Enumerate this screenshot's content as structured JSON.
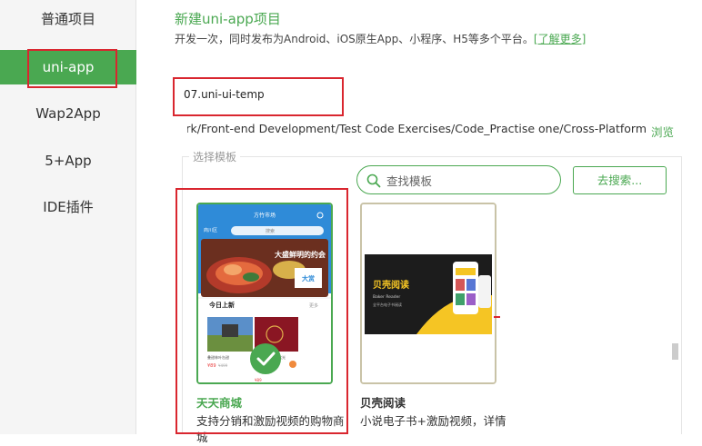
{
  "sidebar": {
    "items": [
      {
        "label": "普通项目"
      },
      {
        "label": "uni-app"
      },
      {
        "label": "Wap2App"
      },
      {
        "label": "5+App"
      },
      {
        "label": "IDE插件"
      }
    ]
  },
  "header": {
    "title": "新建uni-app项目",
    "description": "开发一次，同时发布为Android、iOS原生App、小程序、H5等多个平台。",
    "learn_more": "[了解更多]"
  },
  "project": {
    "name": "07.uni-ui-temp",
    "path": "work/Front-end Development/Test Code Exercises/Code_Practise one/Cross-Platform",
    "browse_label": "浏览"
  },
  "templates": {
    "section_label": "选择模板",
    "search_placeholder": "查找模板",
    "search_button": "去搜索...",
    "cards": [
      {
        "title": "天天商城",
        "description": "支持分销和激励视频的购物商城",
        "preview": {
          "app_title": "方竹市场",
          "location": "商川区",
          "search": "搜索",
          "section": "今日上新",
          "more": "更多",
          "banner": "大盛鲜明的约会",
          "item1": "叠甜林叶缶甜",
          "item2": "夏闲软光",
          "price1": "¥89",
          "price1_old": "¥499",
          "price2": "¥89",
          "small_text": "大赏"
        }
      },
      {
        "title": "贝壳阅读",
        "description": "小说电子书+激励视频，详情",
        "preview": {
          "brand": "贝壳阅读",
          "brand_en": "Baker Reader",
          "tagline": "全平台电子书阅读"
        }
      }
    ]
  },
  "colors": {
    "accent": "#4aa851",
    "highlight": "#d9262f",
    "reader_dark": "#1c1c1c",
    "reader_yellow": "#f5c524",
    "mall_blue": "#2f8bd8"
  }
}
